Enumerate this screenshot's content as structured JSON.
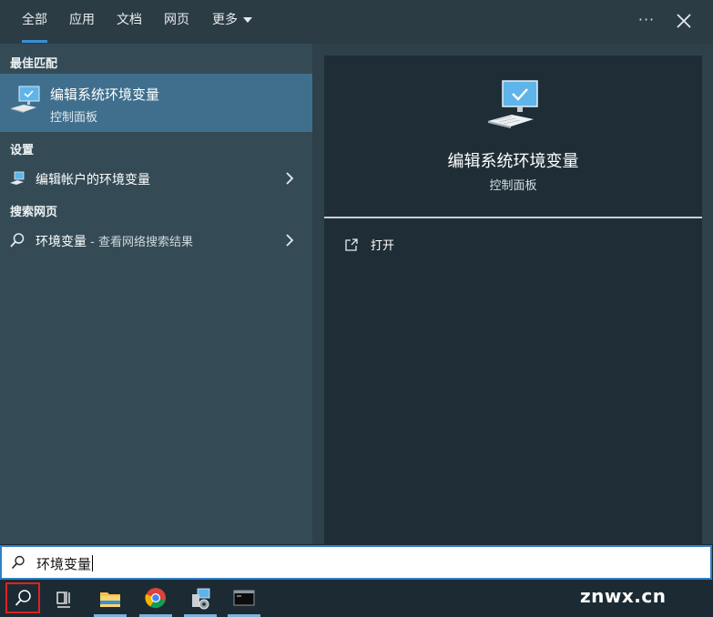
{
  "tabs": [
    {
      "label": "全部",
      "active": true
    },
    {
      "label": "应用",
      "active": false
    },
    {
      "label": "文档",
      "active": false
    },
    {
      "label": "网页",
      "active": false
    },
    {
      "label": "更多",
      "active": false
    }
  ],
  "top_actions": {
    "more_label": "···",
    "close_icon": "close-icon"
  },
  "left": {
    "best_match_title": "最佳匹配",
    "best_match": {
      "title": "编辑系统环境变量",
      "subtitle": "控制面板",
      "icon": "monitor-check-icon"
    },
    "settings_title": "设置",
    "settings_items": [
      {
        "label": "编辑帐户的环境变量",
        "icon": "settings-monitor-icon"
      }
    ],
    "web_title": "搜索网页",
    "web_items": [
      {
        "query": "环境变量",
        "suffix": " - 查看网络搜索结果",
        "icon": "search-icon"
      }
    ]
  },
  "detail": {
    "title": "编辑系统环境变量",
    "subtitle": "控制面板",
    "actions": [
      {
        "label": "打开",
        "icon": "open-external-icon"
      }
    ]
  },
  "search": {
    "value": "环境变量"
  },
  "taskbar": {
    "items": [
      "search-icon",
      "task-view-icon",
      "file-explorer-icon",
      "chrome-icon",
      "system-settings-icon",
      "terminal-icon"
    ],
    "watermark": "znwx.cn"
  },
  "colors": {
    "accent": "#3b8ed8",
    "selected": "#3f6f8d",
    "highlight_border": "#e02020"
  }
}
